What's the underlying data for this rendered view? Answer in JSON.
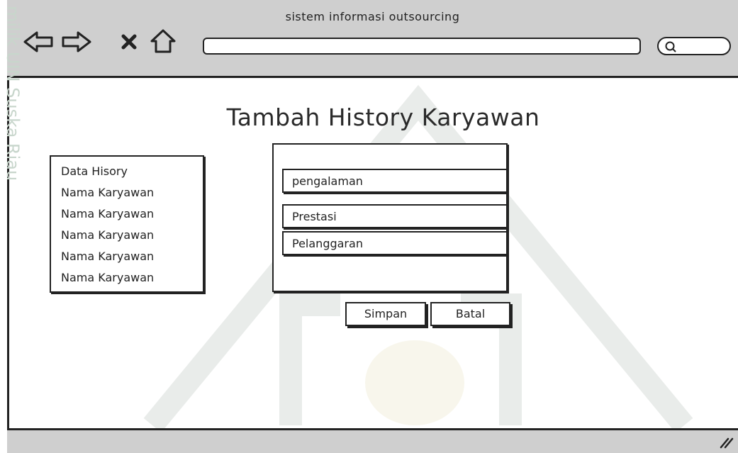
{
  "window": {
    "title": "sistem informasi outsourcing"
  },
  "toolbar": {
    "icons": [
      "back-arrow-icon",
      "forward-arrow-icon",
      "close-x-icon",
      "home-icon"
    ],
    "url_value": "",
    "search_value": ""
  },
  "page": {
    "title": "Tambah History Karyawan"
  },
  "history_list": {
    "header": "Data Hisory",
    "items": [
      "Nama Karyawan",
      "Nama Karyawan",
      "Nama Karyawan",
      "Nama Karyawan",
      "Nama Karyawan"
    ]
  },
  "form": {
    "fields": [
      "pengalaman",
      "Prestasi",
      "Pelanggaran"
    ]
  },
  "buttons": {
    "save_label": "Simpan",
    "cancel_label": "Batal"
  },
  "watermark": {
    "text": "milik UIN Suska Riau"
  }
}
